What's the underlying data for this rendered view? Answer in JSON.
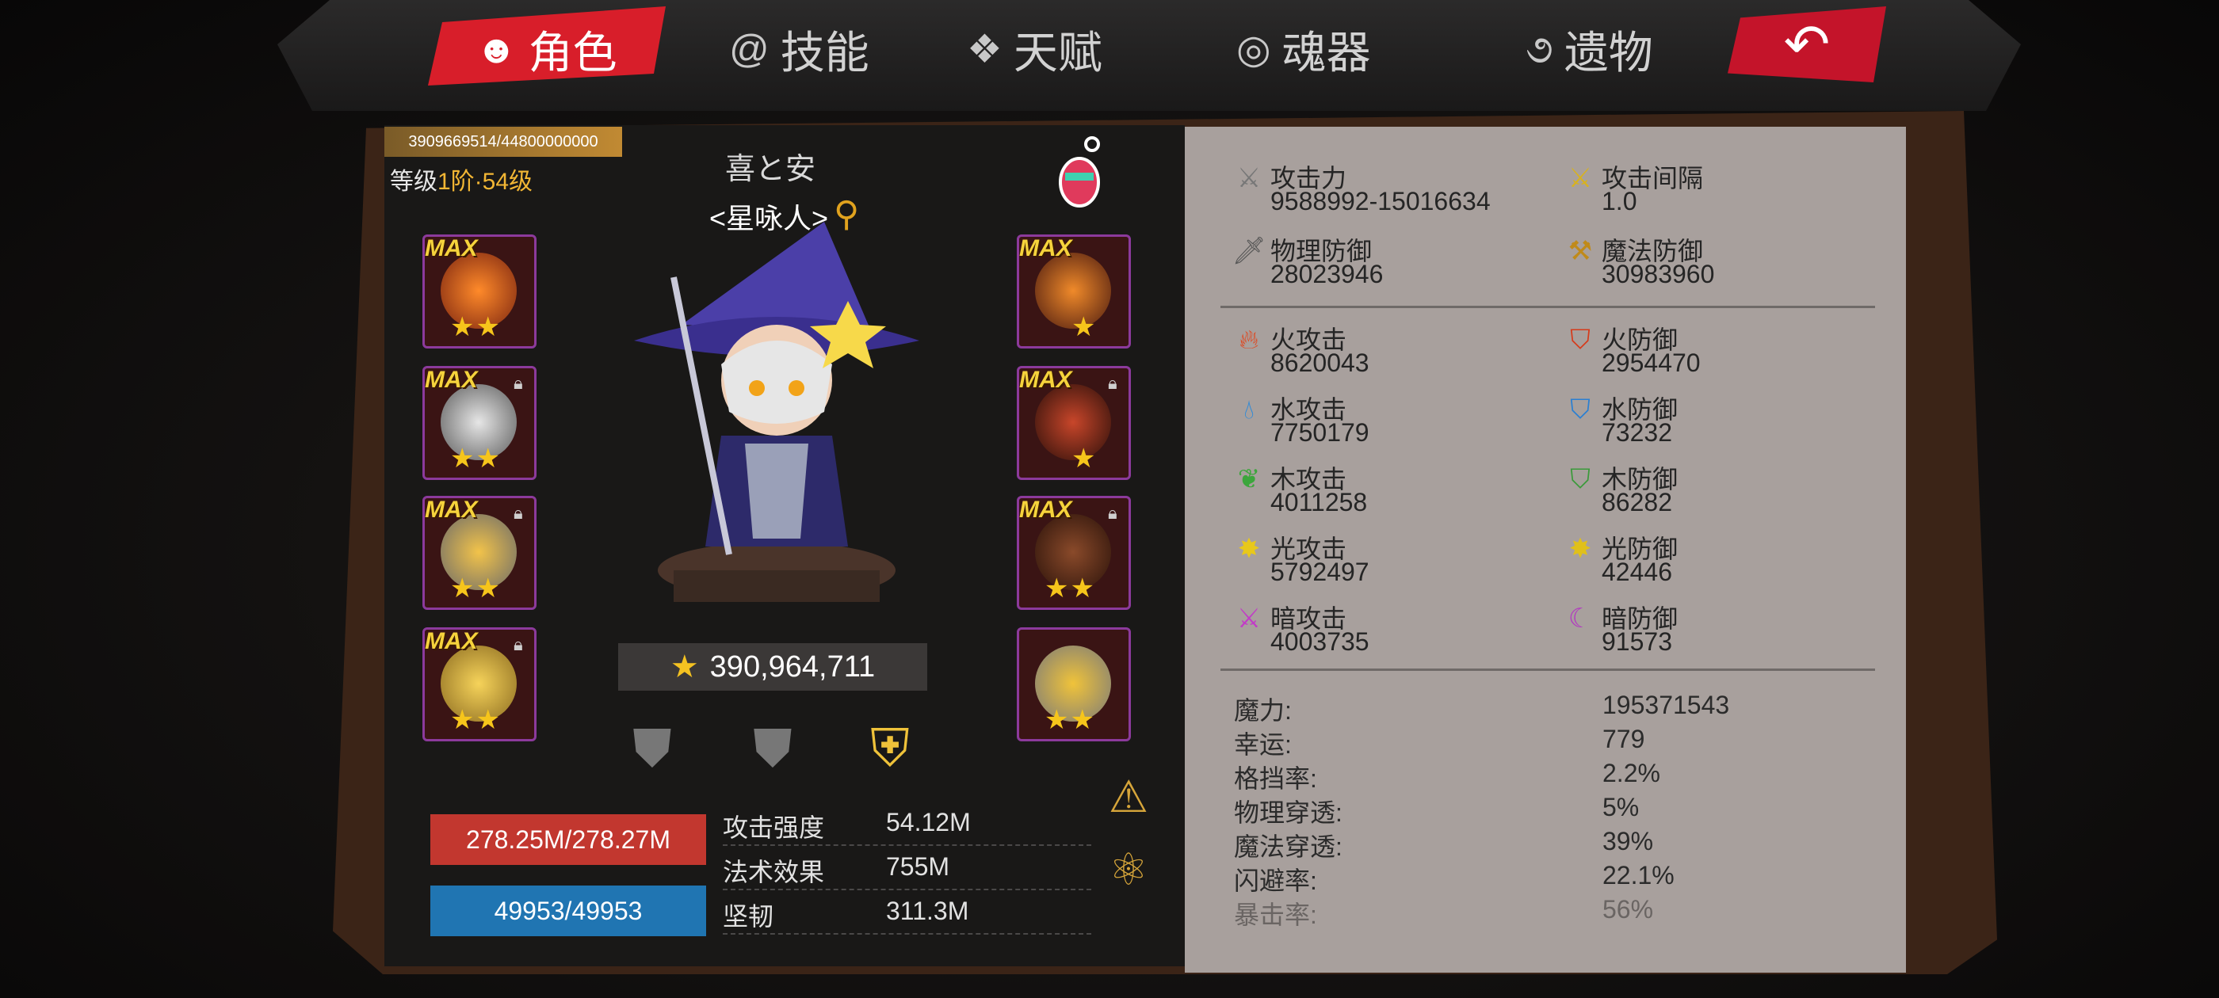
{
  "tabs": [
    {
      "label": "角色",
      "icon": "devil-icon",
      "active": true
    },
    {
      "label": "技能",
      "icon": "swirl-icon",
      "active": false
    },
    {
      "label": "天赋",
      "icon": "wings-icon",
      "active": false
    },
    {
      "label": "魂器",
      "icon": "soul-icon",
      "active": false
    },
    {
      "label": "遗物",
      "icon": "relic-icon",
      "active": false
    }
  ],
  "back_icon": "return-arrow-icon",
  "character": {
    "exp": "3909669514/44800000000",
    "level_prefix": "等级",
    "level_value": "1阶·54级",
    "name": "喜と安",
    "class": "<星咏人>",
    "power": "390,964,711",
    "hp": "278.25M/278.27M",
    "mp": "49953/49953"
  },
  "equipment_left": [
    {
      "badge": "MAX",
      "stars": "★★",
      "color": "#c4441a"
    },
    {
      "badge": "MAX",
      "stars": "★★",
      "color": "#8a8a8a"
    },
    {
      "badge": "MAX",
      "stars": "★★",
      "color": "#b0b0b0"
    },
    {
      "badge": "MAX",
      "stars": "★★",
      "color": "#c79a28"
    }
  ],
  "equipment_right": [
    {
      "badge": "MAX",
      "stars": "★",
      "color": "#b7451b"
    },
    {
      "badge": "MAX",
      "stars": "★",
      "color": "#7a2c18"
    },
    {
      "badge": "MAX",
      "stars": "★★",
      "color": "#6a3520"
    },
    {
      "badge": "MAX",
      "stars": "★★",
      "color": "#9a9a9a"
    }
  ],
  "substats": [
    {
      "label": "攻击强度",
      "value": "54.12M"
    },
    {
      "label": "法术效果",
      "value": "755M"
    },
    {
      "label": "坚韧",
      "value": "311.3M"
    }
  ],
  "stats_basic": [
    {
      "label": "攻击力",
      "value": "9588992-15016634",
      "icon": "sword-icon"
    },
    {
      "label": "攻击间隔",
      "value": "1.0",
      "icon": "sword-speed-icon"
    },
    {
      "label": "物理防御",
      "value": "28023946",
      "icon": "blade-icon"
    },
    {
      "label": "魔法防御",
      "value": "30983960",
      "icon": "hammer-icon"
    }
  ],
  "stats_elemental": [
    {
      "label": "火攻击",
      "value": "8620043",
      "icon": "fire-attack-icon"
    },
    {
      "label": "火防御",
      "value": "2954470",
      "icon": "fire-defense-icon"
    },
    {
      "label": "水攻击",
      "value": "7750179",
      "icon": "water-attack-icon"
    },
    {
      "label": "水防御",
      "value": "73232",
      "icon": "water-defense-icon"
    },
    {
      "label": "木攻击",
      "value": "4011258",
      "icon": "wood-attack-icon"
    },
    {
      "label": "木防御",
      "value": "86282",
      "icon": "wood-defense-icon"
    },
    {
      "label": "光攻击",
      "value": "5792497",
      "icon": "light-attack-icon"
    },
    {
      "label": "光防御",
      "value": "42446",
      "icon": "light-defense-icon"
    },
    {
      "label": "暗攻击",
      "value": "4003735",
      "icon": "dark-attack-icon"
    },
    {
      "label": "暗防御",
      "value": "91573",
      "icon": "dark-defense-icon"
    }
  ],
  "attributes": [
    {
      "label": "魔力:",
      "value": "195371543"
    },
    {
      "label": "幸运:",
      "value": "779"
    },
    {
      "label": "格挡率:",
      "value": "2.2%"
    },
    {
      "label": "物理穿透:",
      "value": "5%"
    },
    {
      "label": "魔法穿透:",
      "value": "39%"
    },
    {
      "label": "闪避率:",
      "value": "22.1%"
    },
    {
      "label": "暴击率:",
      "value": "56%"
    }
  ]
}
